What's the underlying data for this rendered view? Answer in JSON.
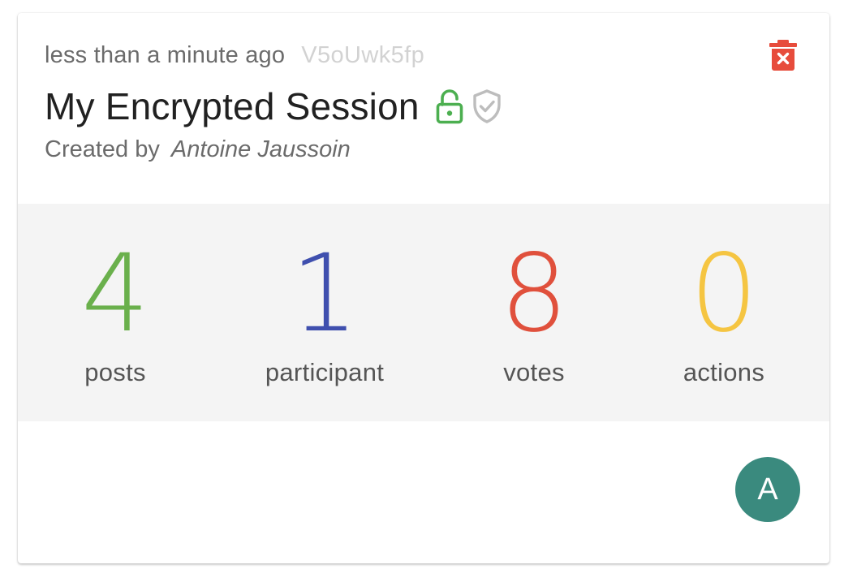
{
  "session": {
    "time_ago": "less than a minute ago",
    "id": "V5oUwk5fp",
    "title": "My Encrypted Session",
    "created_by_prefix": "Created by",
    "author": "Antoine Jaussoin"
  },
  "icons": {
    "delete": "trash-x-icon",
    "lock": "unlocked-padlock-icon",
    "shield": "shield-check-icon"
  },
  "colors": {
    "delete": "#e74c3c",
    "lock": "#4caf50",
    "shield": "#bdbdbd",
    "avatar_bg": "#3a8a7e"
  },
  "stats": [
    {
      "value": "4",
      "label": "posts",
      "color": "#6ab04c"
    },
    {
      "value": "1",
      "label": "participant",
      "color": "#3f4fae"
    },
    {
      "value": "8",
      "label": "votes",
      "color": "#e0503c"
    },
    {
      "value": "0",
      "label": "actions",
      "color": "#f5c542"
    }
  ],
  "participants": [
    {
      "initial": "A"
    }
  ]
}
